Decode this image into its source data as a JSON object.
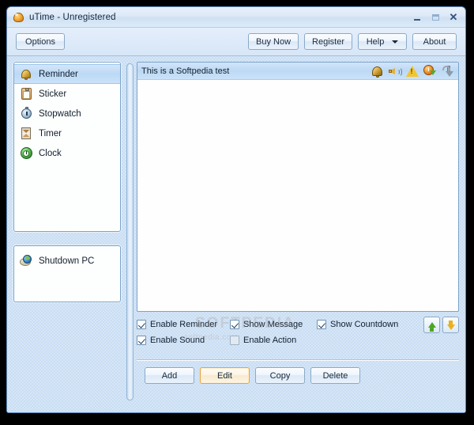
{
  "window": {
    "title": "uTime - Unregistered",
    "icon": "utime-app-icon",
    "controls": {
      "minimize": "–",
      "maximize": "□",
      "close": "✕"
    }
  },
  "toolbar": {
    "options_label": "Options",
    "buy_now_label": "Buy Now",
    "register_label": "Register",
    "help_label": "Help",
    "about_label": "About"
  },
  "sidebar": {
    "nav_items": [
      {
        "label": "Reminder",
        "icon": "bell-icon",
        "selected": true
      },
      {
        "label": "Sticker",
        "icon": "clipboard-icon",
        "selected": false
      },
      {
        "label": "Stopwatch",
        "icon": "stopwatch-icon",
        "selected": false
      },
      {
        "label": "Timer",
        "icon": "hourglass-icon",
        "selected": false
      },
      {
        "label": "Clock",
        "icon": "clock-icon",
        "selected": false
      }
    ],
    "action_items": [
      {
        "label": "Shutdown PC",
        "icon": "shutdown-pc-icon"
      }
    ]
  },
  "main": {
    "list_rows": [
      {
        "text": "This is a Softpedia test",
        "selected": true,
        "icons": [
          "bell-icon",
          "speaker-icon",
          "warning-icon",
          "countdown-icon",
          "return-arrow-icon"
        ]
      }
    ],
    "checkboxes": [
      {
        "label": "Enable Reminder",
        "checked": true,
        "name": "enable-reminder"
      },
      {
        "label": "Show Message",
        "checked": true,
        "name": "show-message"
      },
      {
        "label": "Show Countdown",
        "checked": true,
        "name": "show-countdown"
      },
      {
        "label": "Enable Sound",
        "checked": true,
        "name": "enable-sound"
      },
      {
        "label": "Enable Action",
        "checked": false,
        "name": "enable-action"
      }
    ],
    "reorder": {
      "move_up": "move-up-arrow",
      "move_down": "move-down-arrow"
    },
    "action_buttons": [
      {
        "label": "Add",
        "focused": false
      },
      {
        "label": "Edit",
        "focused": true
      },
      {
        "label": "Copy",
        "focused": false
      },
      {
        "label": "Delete",
        "focused": false
      }
    ]
  },
  "watermark": {
    "line1": "SOFTPEDIA",
    "line2": "softpedia.com"
  },
  "colors": {
    "window_bg": "#cfe0f5",
    "body_bg": "#c9ddf3",
    "panel_bg": "#fdfefe",
    "selection": "#bcd9f4",
    "border": "#7ba3cb",
    "focus_accent": "#e8a33d",
    "text": "#16283a"
  }
}
